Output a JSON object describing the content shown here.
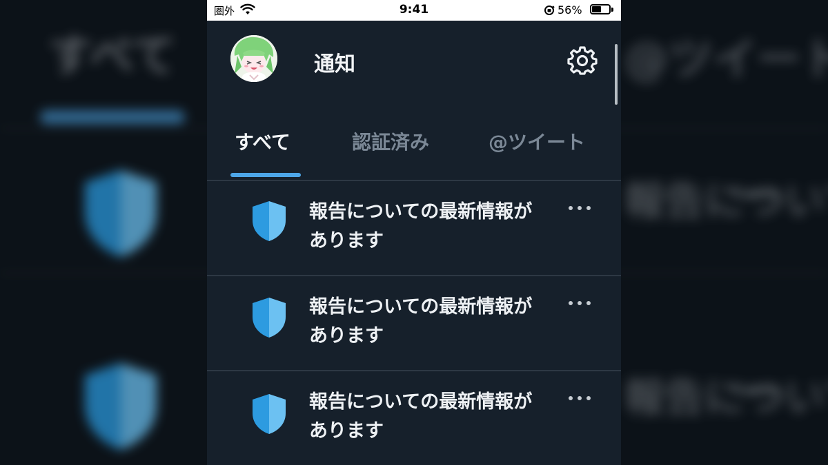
{
  "status_bar": {
    "carrier": "圏外",
    "time": "9:41",
    "battery_percent_label": "56%",
    "battery_level": 0.56
  },
  "header": {
    "title": "通知",
    "avatar_icon": "anime-character-avatar",
    "settings_icon": "gear-icon"
  },
  "tabs": [
    {
      "label": "すべて",
      "active": true
    },
    {
      "label": "認証済み",
      "active": false
    },
    {
      "label": "@ツイート",
      "active": false
    }
  ],
  "notifications": [
    {
      "icon": "shield-icon",
      "line1": "報告についての最新情報が",
      "line2": "あります"
    },
    {
      "icon": "shield-icon",
      "line1": "報告についての最新情報が",
      "line2": "あります"
    },
    {
      "icon": "shield-icon",
      "line1": "報告についての最新情報が",
      "line2": "あります"
    }
  ],
  "colors": {
    "background": "#16202b",
    "accent": "#4da6e8",
    "shield_dark": "#2d9be0",
    "shield_light": "#6cc1f2",
    "text_primary": "#f2f4f6",
    "text_secondary": "#7b8896"
  }
}
